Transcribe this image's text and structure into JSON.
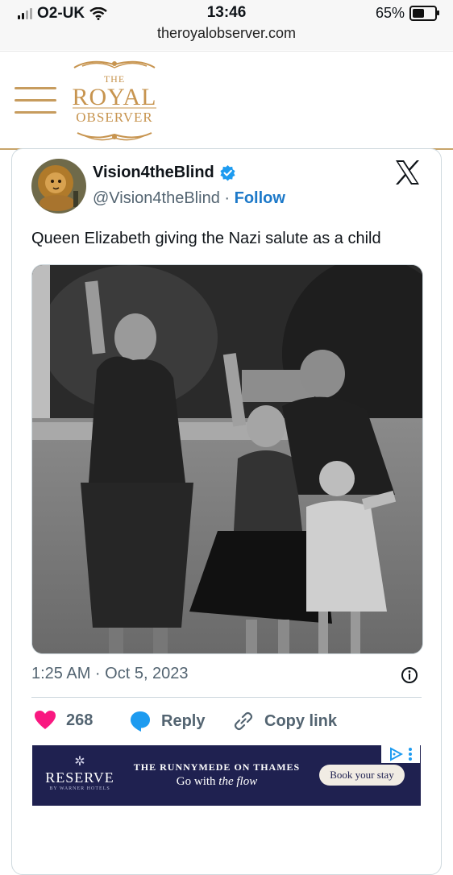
{
  "status_bar": {
    "carrier": "O2-UK",
    "time": "13:46",
    "battery": "65%",
    "battery_level": 0.65,
    "url": "theroyalobserver.com"
  },
  "site": {
    "logo_the": "THE",
    "logo_royal": "ROYAL",
    "logo_observer": "OBSERVER"
  },
  "tweet": {
    "display_name": "Vision4theBlind",
    "handle": "@Vision4theBlind",
    "separator": "·",
    "follow_label": "Follow",
    "text": "Queen Elizabeth giving the Nazi salute as a child",
    "timestamp": "1:25 AM · Oct 5, 2023",
    "likes": "268",
    "reply_label": "Reply",
    "copy_label": "Copy link"
  },
  "icons": {
    "menu": "hamburger-icon",
    "verified": "verified-badge-icon",
    "x": "x-logo-icon",
    "info": "info-icon",
    "like": "heart-icon",
    "reply": "speech-bubble-icon",
    "copy": "link-icon",
    "adchoices": "adchoices-icon"
  },
  "colors": {
    "accent_gold": "#c7944f",
    "follow_blue": "#1d79c9",
    "like_pink": "#f91880",
    "reply_blue": "#1d9bf0",
    "ad_navy": "#1f2150"
  },
  "ad": {
    "brand": "RESERVE",
    "brand_sub": "BY WARNER HOTELS",
    "headline": "THE RUNNYMEDE ON THAMES",
    "tagline_prefix": "Go with",
    "tagline_em": "the flow",
    "cta": "Book your stay"
  }
}
